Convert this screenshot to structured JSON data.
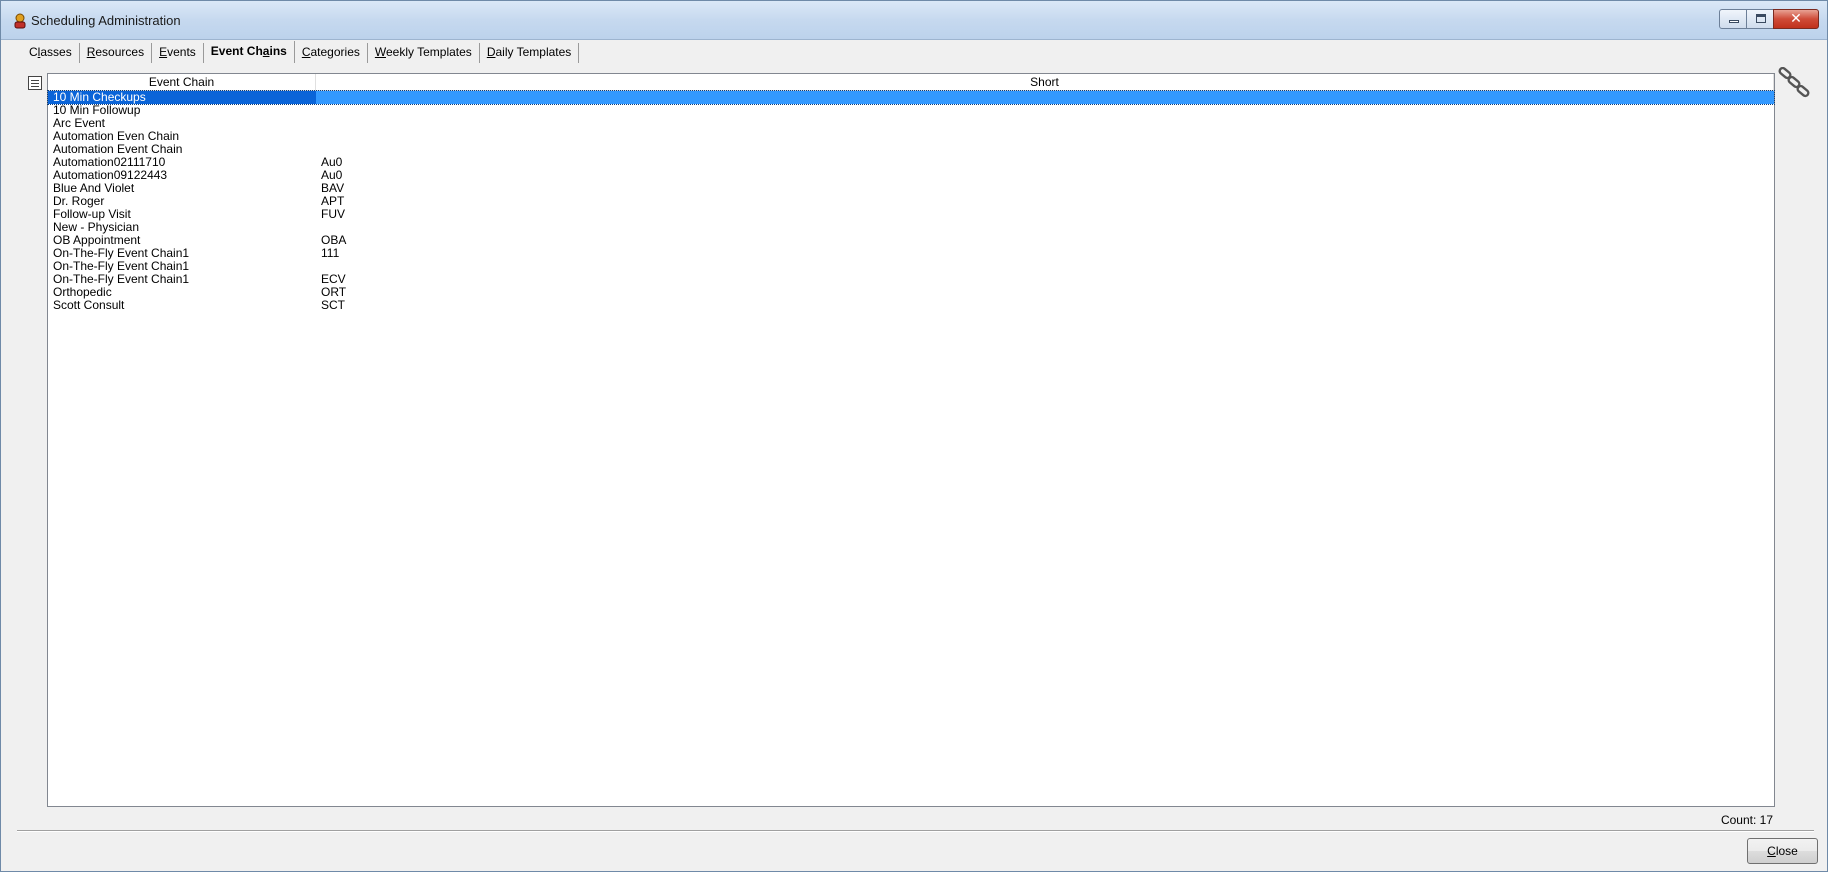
{
  "window": {
    "title": "Scheduling Administration"
  },
  "tabs": [
    {
      "pre": "C",
      "u": "l",
      "post": "asses"
    },
    {
      "pre": "",
      "u": "R",
      "post": "esources"
    },
    {
      "pre": "",
      "u": "E",
      "post": "vents"
    },
    {
      "pre": "Event Ch",
      "u": "a",
      "post": "ins"
    },
    {
      "pre": "",
      "u": "C",
      "post": "ategories"
    },
    {
      "pre": "",
      "u": "W",
      "post": "eekly Templates"
    },
    {
      "pre": "",
      "u": "D",
      "post": "aily Templates"
    }
  ],
  "active_tab_index": 3,
  "grid": {
    "columns": [
      "Event Chain",
      "Short"
    ],
    "selected_row_index": 0,
    "rows": [
      {
        "name": "10 Min Checkups",
        "short": ""
      },
      {
        "name": "10 Min Followup",
        "short": ""
      },
      {
        "name": "Arc Event",
        "short": ""
      },
      {
        "name": "Automation Even Chain",
        "short": ""
      },
      {
        "name": "Automation Event Chain",
        "short": ""
      },
      {
        "name": "Automation02111710",
        "short": "Au0"
      },
      {
        "name": "Automation09122443",
        "short": "Au0"
      },
      {
        "name": "Blue And Violet",
        "short": "BAV"
      },
      {
        "name": "Dr. Roger",
        "short": "APT"
      },
      {
        "name": "Follow-up Visit",
        "short": "FUV"
      },
      {
        "name": "New - Physician",
        "short": ""
      },
      {
        "name": "OB Appointment",
        "short": "OBA"
      },
      {
        "name": "On-The-Fly Event Chain1",
        "short": "111"
      },
      {
        "name": "On-The-Fly Event Chain1",
        "short": ""
      },
      {
        "name": "On-The-Fly Event Chain1",
        "short": "ECV"
      },
      {
        "name": "Orthopedic",
        "short": "ORT"
      },
      {
        "name": "Scott Consult",
        "short": "SCT"
      }
    ]
  },
  "count_label": "Count: 17",
  "close_button": {
    "pre": "",
    "u": "C",
    "post": "lose"
  },
  "colors": {
    "selection": "#3399ff",
    "close_button_red": "#c0311c"
  },
  "icons": [
    "app-icon",
    "grid-menu-icon",
    "chain-link-icon",
    "minimize-icon",
    "maximize-icon",
    "close-icon"
  ]
}
